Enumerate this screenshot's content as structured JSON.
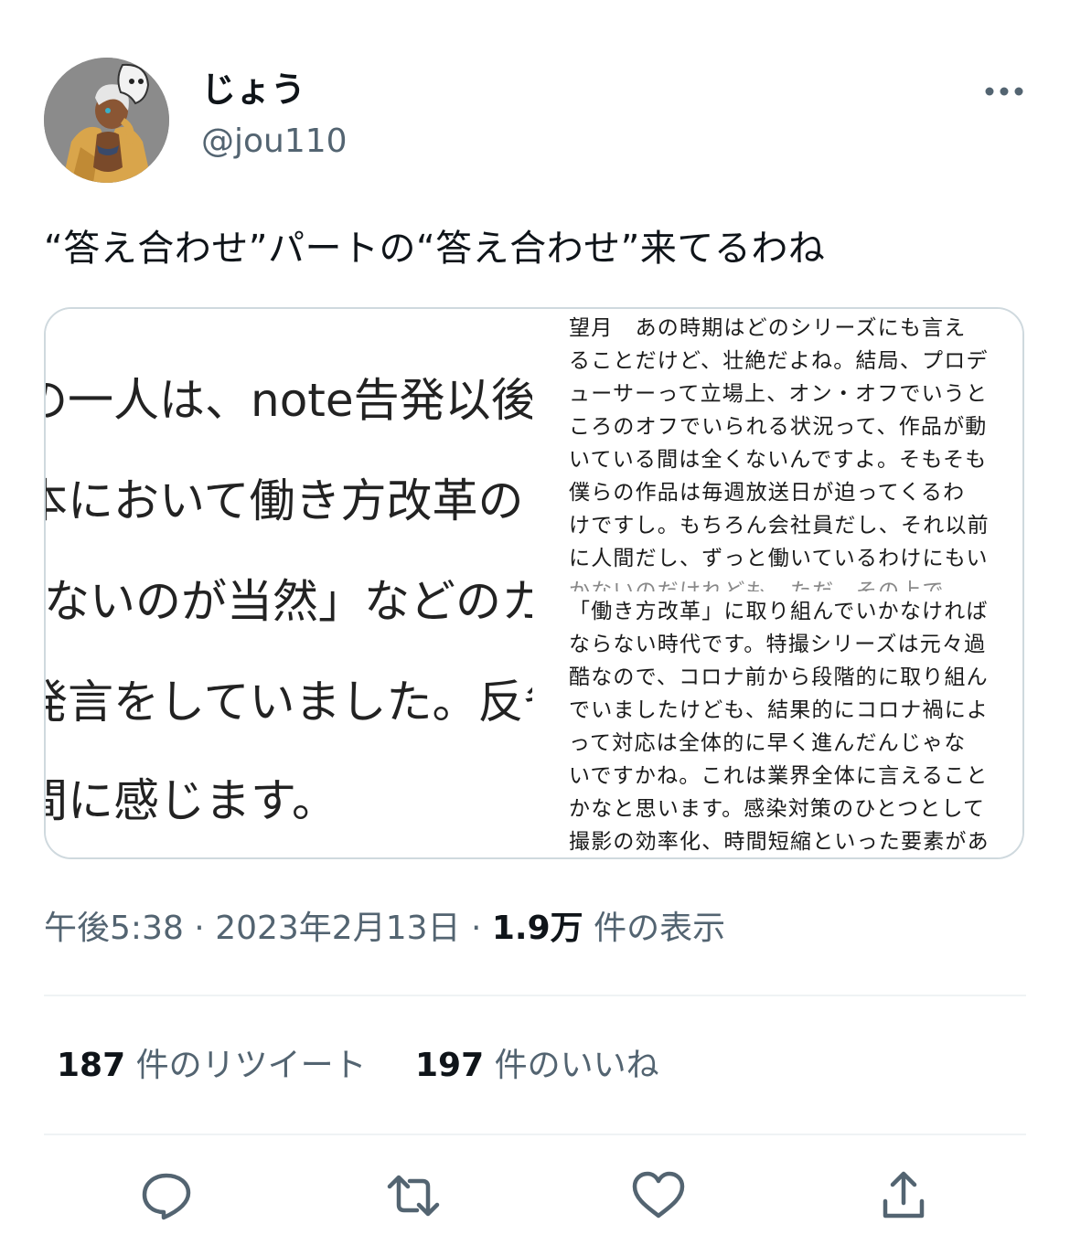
{
  "user": {
    "display_name": "じょう",
    "handle": "@jou110"
  },
  "tweet": {
    "text": "“答え合わせ”パートの“答え合わせ”来てるわね"
  },
  "media": {
    "left_lines": [
      "の一人は、note告発以後",
      "本において働き方改革の",
      "ないのが当然」などのカ",
      "発言をしていました。反省",
      "間に感じます。"
    ],
    "right_lines": [
      "望月　あの時期はどのシリーズにも言え",
      "ることだけど、壮絶だよね。結局、プロデ",
      "ューサーって立場上、オン・オフでいうと",
      "ころのオフでいられる状況って、作品が動",
      "いている間は全くないんですよ。そもそも",
      "僕らの作品は毎週放送日が迫ってくるわ",
      "けですし。もちろん会社員だし、それ以前",
      "に人間だし、ずっと働いているわけにもい",
      "かないのだけれども。ただ、その上で",
      "「働き方改革」に取り組んでいかなければ",
      "ならない時代です。特撮シリーズは元々過",
      "酷なので、コロナ前から段階的に取り組ん",
      "でいましたけども、結果的にコロナ禍によ",
      "って対応は全体的に早く進んだんじゃな",
      "いですかね。これは業界全体に言えること",
      "かなと思います。感染対策のひとつとして",
      "撮影の効率化、時間短縮といった要素があ"
    ]
  },
  "meta": {
    "time": "午後5:38",
    "separator": " · ",
    "date": "2023年2月13日",
    "views_count": "1.9万",
    "views_label": " 件の表示"
  },
  "stats": {
    "retweets_count": "187",
    "retweets_label": " 件のリツイート",
    "likes_count": "197",
    "likes_label": " 件のいいね"
  },
  "icons": {
    "more": "more-icon",
    "reply": "reply-icon",
    "retweet": "retweet-icon",
    "like": "heart-icon",
    "share": "share-icon"
  },
  "colors": {
    "text": "#0f1419",
    "secondary": "#536471",
    "divider": "#eff3f4",
    "card_border": "#cfd9de"
  }
}
